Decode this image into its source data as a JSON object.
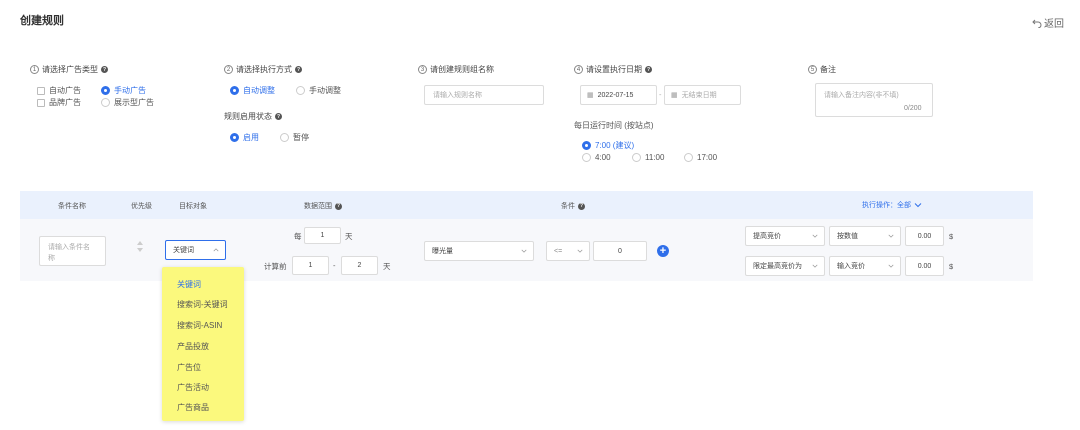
{
  "page": {
    "title": "创建规则",
    "back_label": "返回"
  },
  "step1": {
    "num": "1",
    "label": "请选择广告类型",
    "options": [
      "自动广告",
      "手动广告",
      "品牌广告",
      "展示型广告"
    ]
  },
  "step2": {
    "num": "2",
    "label": "请选择执行方式",
    "options": [
      "自动调整",
      "手动调整"
    ],
    "status_label": "规则启用状态",
    "status_options": [
      "启用",
      "暂停"
    ]
  },
  "step3": {
    "num": "3",
    "label": "请创建规则组名称",
    "placeholder": "请输入规则名称"
  },
  "step4": {
    "num": "4",
    "label": "请设置执行日期",
    "start_date": "2022-07-15",
    "end_placeholder": "无结束日期",
    "time_label": "每日运行时间 (按站点)",
    "times": [
      "7:00 (建议)",
      "4:00",
      "11:00",
      "17:00"
    ]
  },
  "step5": {
    "num": "5",
    "label": "备注",
    "placeholder": "请输入备注内容(非不填)",
    "counter": "0/200"
  },
  "table": {
    "headers": {
      "name": "条件名称",
      "priority": "优先级",
      "target": "目标对象",
      "range": "数据范围",
      "condition": "条件",
      "action": "执行操作：全部"
    },
    "row": {
      "name_placeholder": "请输入条件名称",
      "target_value": "关键词",
      "every_label": "每",
      "every_value": "1",
      "day_unit": "天",
      "calc_label": "计算前",
      "calc_from": "1",
      "calc_dash": "-",
      "calc_to": "2",
      "metric": "曝光量",
      "operator": "<=",
      "cond_value": "0",
      "action1": "提高竞价",
      "action1_mode": "按数值",
      "action1_value": "0.00",
      "currency": "$",
      "action2": "限定最高竞价为",
      "action2_mode": "输入竞价",
      "action2_value": "0.00"
    }
  },
  "dropdown": {
    "items": [
      "关键词",
      "搜索词-关键词",
      "搜索词-ASIN",
      "产品投放",
      "广告位",
      "广告活动",
      "广告商品"
    ]
  },
  "colors": {
    "accent": "#2f6fea",
    "highlight": "#fbf97d",
    "header_bg": "#eaf1fd"
  }
}
